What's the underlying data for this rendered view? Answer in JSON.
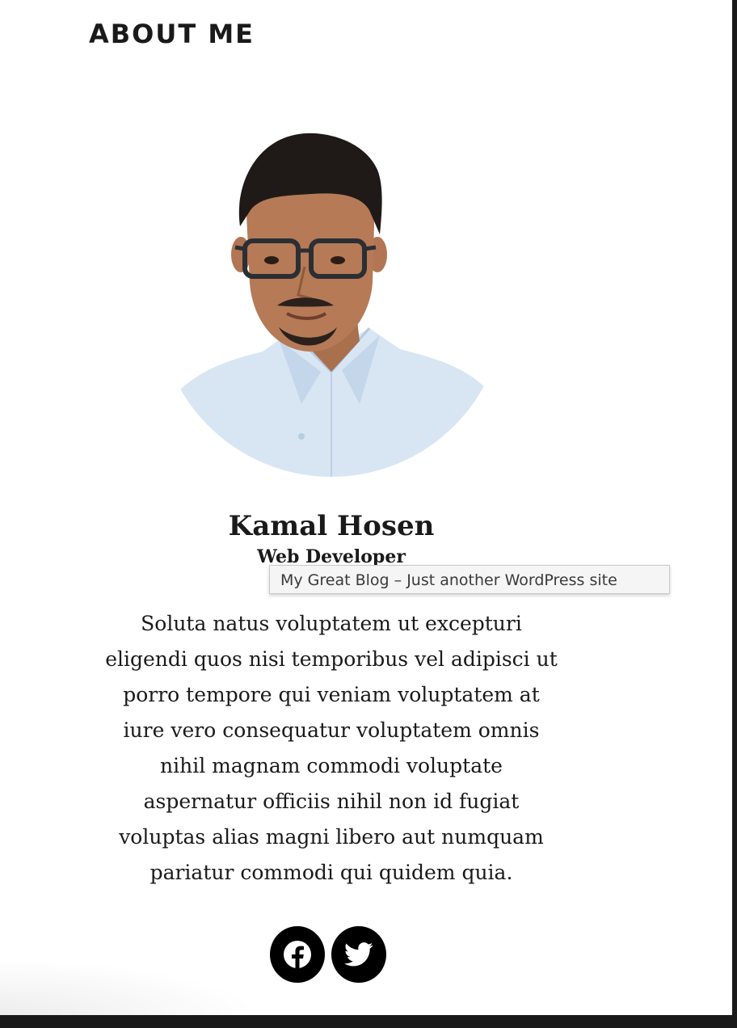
{
  "widget": {
    "title": "ABOUT ME"
  },
  "profile": {
    "name": "Kamal Hosen",
    "role": "Web Developer",
    "bio_lines": [
      "Soluta natus voluptatem ut excepturi",
      "eligendi quos nisi temporibus vel adipisci ut",
      "porro tempore qui veniam voluptatem at",
      "iure vero consequatur voluptatem omnis",
      "nihil magnam commodi voluptate",
      "aspernatur officiis nihil non id fugiat",
      "voluptas alias magni libero aut numquam",
      "pariatur commodi qui quidem quia."
    ]
  },
  "tooltip": {
    "text": "My Great Blog – Just another WordPress site"
  },
  "social": [
    {
      "icon": "facebook-icon"
    },
    {
      "icon": "twitter-icon"
    }
  ],
  "colors": {
    "text": "#1a1a1a",
    "social_bg": "#000000",
    "shirt": "#d8e6f4"
  }
}
